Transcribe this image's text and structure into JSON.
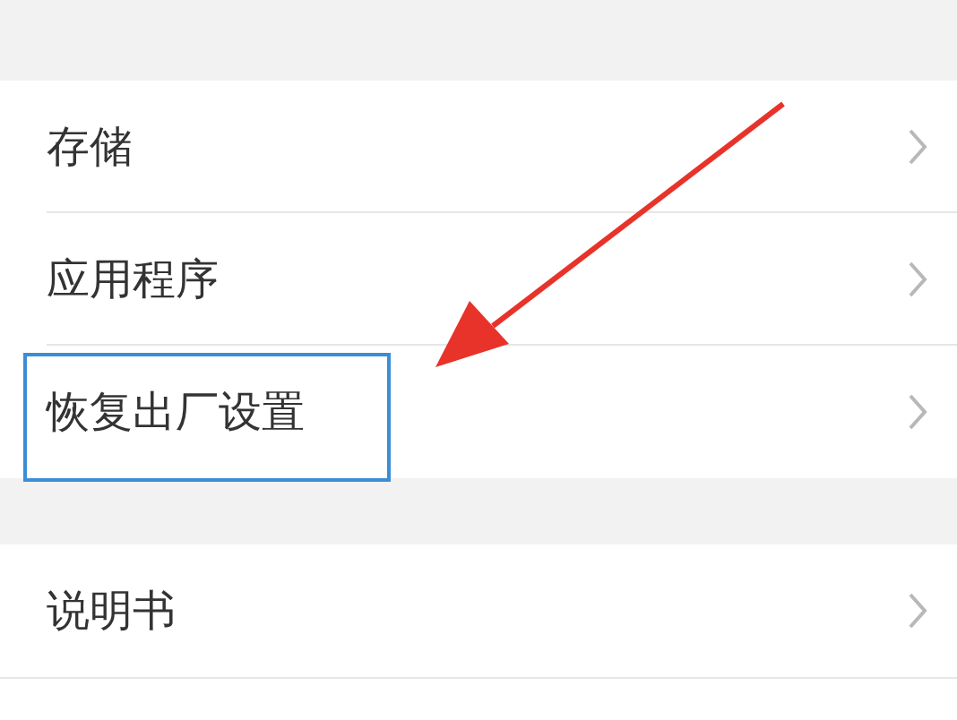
{
  "sections": [
    {
      "items": [
        {
          "label": "存储",
          "highlighted": false
        },
        {
          "label": "应用程序",
          "highlighted": false
        },
        {
          "label": "恢复出厂设置",
          "highlighted": true
        }
      ]
    },
    {
      "items": [
        {
          "label": "说明书",
          "highlighted": false
        }
      ]
    }
  ]
}
